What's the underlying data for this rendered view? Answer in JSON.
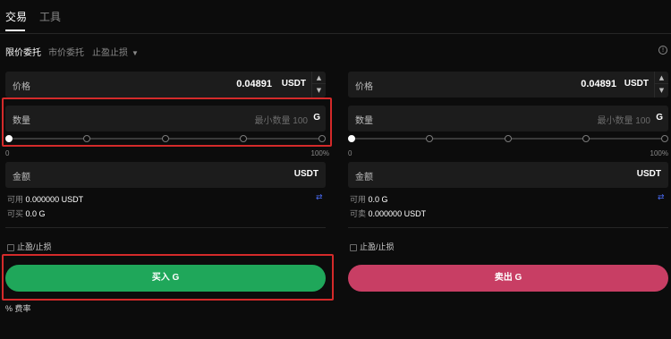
{
  "top_tabs": {
    "trade": "交易",
    "tools": "工具"
  },
  "order_tabs": {
    "limit": "限价委托",
    "market": "市价委托",
    "stop": "止盈止损"
  },
  "buy_panel": {
    "price_label": "价格",
    "price_value": "0.04891",
    "price_unit": "USDT",
    "qty_label": "数量",
    "qty_placeholder": "最小数量 100",
    "qty_unit": "G",
    "slider_min": "0",
    "slider_max": "100%",
    "slider_value_percent": 0,
    "amount_label": "金额",
    "amount_unit": "USDT",
    "available_label": "可用",
    "available_value": "0.000000 USDT",
    "can_label": "可买",
    "can_value": "0.0 G",
    "tpsl_label": "止盈/止损",
    "action_label": "买入 G"
  },
  "sell_panel": {
    "price_label": "价格",
    "price_value": "0.04891",
    "price_unit": "USDT",
    "qty_label": "数量",
    "qty_placeholder": "最小数量 100",
    "qty_unit": "G",
    "slider_min": "0",
    "slider_max": "100%",
    "slider_value_percent": 0,
    "amount_label": "金额",
    "amount_unit": "USDT",
    "available_label": "可用",
    "available_value": "0.0 G",
    "can_label": "可卖",
    "can_value": "0.000000 USDT",
    "tpsl_label": "止盈/止损",
    "action_label": "卖出 G"
  },
  "fee": {
    "icon": "%",
    "label": "费率"
  },
  "colors": {
    "buy": "#1fa75a",
    "sell": "#c83e64",
    "highlight": "#d42a2a",
    "accent": "#4a6cf7"
  },
  "icons": {
    "swap": "swap-icon",
    "info": "info-icon",
    "chevron": "chevron-down-icon"
  }
}
